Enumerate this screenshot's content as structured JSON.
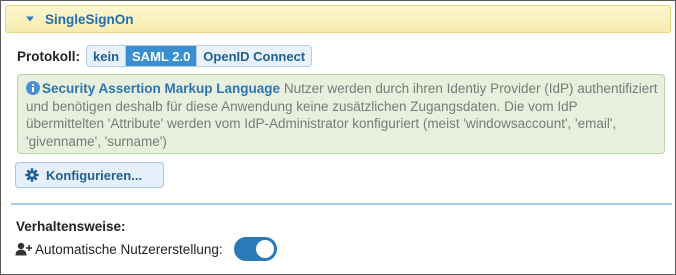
{
  "panel": {
    "title": "SingleSignOn"
  },
  "protocol": {
    "label": "Protokoll:",
    "options": [
      "kein",
      "SAML 2.0",
      "OpenID Connect"
    ],
    "selected": "SAML 2.0"
  },
  "info": {
    "heading": "Security Assertion Markup Language",
    "text": "Nutzer werden durch ihren Identiy Provider (IdP) authentifiziert und benötigen deshalb für diese Anwendung keine zusätzlichen Zugangsdaten. Die vom IdP übermittelten 'Attribute' werden vom IdP-Administrator konfiguriert (meist 'windowsaccount', 'email', 'givenname', 'surname')",
    "icon": "info-circle-icon"
  },
  "configure_button": {
    "label": "Konfigurieren...",
    "icon": "gear-icon"
  },
  "behavior": {
    "title": "Verhaltensweise:",
    "auto_create_label": "Automatische Nutzererstellung:",
    "auto_create_icon": "user-plus-icon",
    "auto_create_enabled": true
  },
  "colors": {
    "accent": "#1f6fb2",
    "selected_option": "#3a8fd0",
    "toggle_on": "#2a7ab8",
    "info_background": "#e6f0dc",
    "header_background": "#f6ecaf"
  }
}
